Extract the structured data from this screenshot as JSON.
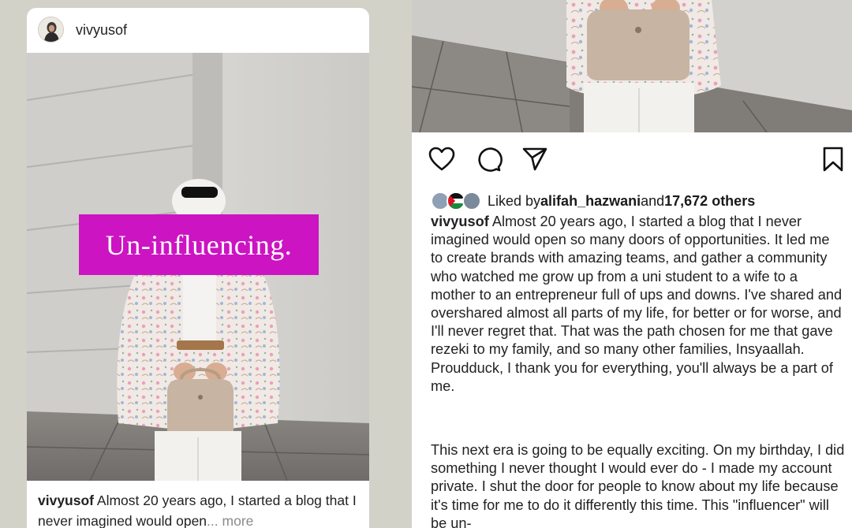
{
  "left_post": {
    "username": "vivyusof",
    "overlay_text": "Un-influencing.",
    "caption_user": "vivyusof",
    "caption_text": " Almost 20 years ago, I started a blog that I never imagined would open",
    "ellipsis": "...",
    "more_label": " more"
  },
  "right_post": {
    "liked_by_prefix": "Liked by ",
    "liked_by_user": "alifah_hazwani",
    "liked_by_and": " and ",
    "liked_by_others": "17,672 others",
    "caption_user": "vivyusof",
    "caption_text": " Almost 20 years ago, I started a blog that I never imagined would open so many doors of opportunities. It led me to create brands with amazing teams, and gather a community who watched me grow up from a uni student to a wife to a mother to an entrepreneur full of ups and downs. I've shared and overshared almost all parts of my life, for better or for worse, and I'll never regret that. That was the path chosen for me that gave rezeki to my family, and so many other families, Insyaallah. Proudduck, I thank you for everything, you'll always be a part of me.",
    "caption_text_2": "This next era is going to be equally exciting. On my birthday, I did something I never thought I would ever do - I made my account private. I shut the door for people to know about my life because it's time for me to do it differently this time. This \"influencer\" will be un-"
  },
  "colors": {
    "banner": "#cc14c3",
    "background": "#d3d2c9"
  },
  "icons": [
    "heart-icon",
    "comment-icon",
    "share-icon",
    "bookmark-icon"
  ]
}
